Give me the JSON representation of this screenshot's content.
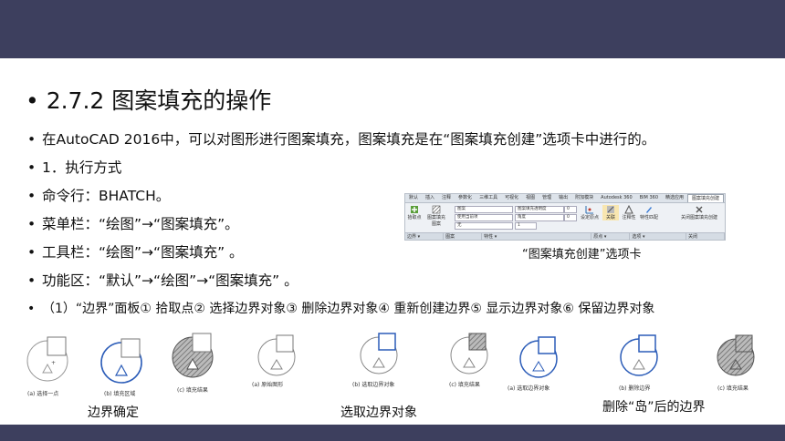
{
  "heading": "2.7.2  图案填充的操作",
  "bullets": [
    "在AutoCAD 2016中，可以对图形进行图案填充，图案填充是在“图案填充创建”选项卡中进行的。",
    "1．执行方式",
    "命令行：BHATCH。",
    "菜单栏：“绘图”→“图案填充”。",
    "工具栏：“绘图”→“图案填充” 。",
    "功能区：“默认”→“绘图”→“图案填充” 。",
    "（1）“边界”面板① 拾取点② 选择边界对象③ 删除边界对象④ 重新创建边界⑤ 显示边界对象⑥ 保留边界对象"
  ],
  "ribbon": {
    "tabs": [
      "默认",
      "插入",
      "注释",
      "参数化",
      "三维工具",
      "可视化",
      "视图",
      "管理",
      "输出",
      "附加模块",
      "Autodesk 360",
      "BIM 360",
      "精选应用",
      "图案填充创建"
    ],
    "buttons": {
      "pick": "拾取点",
      "pattern": "图案填充图案",
      "set_origin": "设定原点",
      "associative": "关联",
      "annotative": "注释性",
      "match": "特性匹配",
      "close": "关闭图案填充创建"
    },
    "fields": {
      "pattern_type": "图案",
      "transparency": "图案填充透明度",
      "color": "使用当前项",
      "angle": "角度",
      "bg": "无",
      "scale": "1",
      "transparency_val": "0",
      "angle_val": "0"
    },
    "groups": [
      "边界 ▾",
      "图案",
      "特性 ▾",
      "原点 ▾",
      "选项 ▾",
      "关闭"
    ]
  },
  "ribbon_caption": "“图案填充创建”选项卡",
  "figure_captions": {
    "g1": [
      "(a) 选择一点",
      "(b) 填充区域",
      "(c) 填充结果"
    ],
    "g2": [
      "(a) 原始图形",
      "(b) 选取边界对象",
      "(c) 填充结果"
    ],
    "g3": [
      "(a) 选取边界对象",
      "(b) 删除边界",
      "(c) 填充结果"
    ]
  },
  "group_captions": [
    "边界确定",
    "选取边界对象",
    "删除“岛”后的边界"
  ]
}
